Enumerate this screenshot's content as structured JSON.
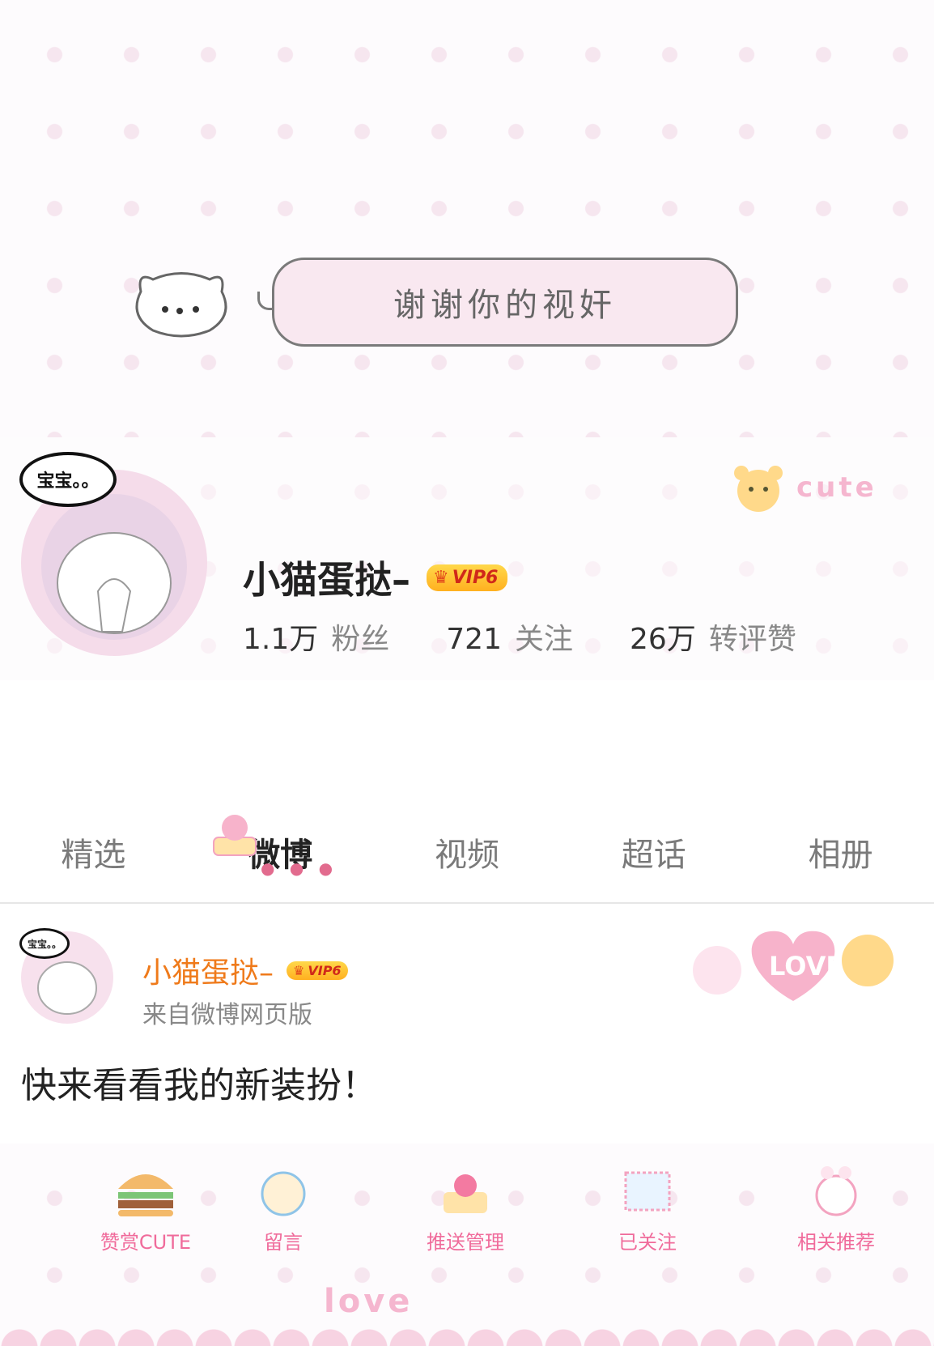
{
  "cover": {
    "bubble_text": "谢谢你的视奸"
  },
  "profile": {
    "avatar_speech": "宝宝。。",
    "username": "小猫蛋挞–",
    "vip_badge": "VIP6",
    "sticker_text": "cute",
    "stats": [
      {
        "value": "1.1万",
        "label": "粉丝"
      },
      {
        "value": "721",
        "label": "关注"
      },
      {
        "value": "26万",
        "label": "转评赞"
      }
    ]
  },
  "tabs": [
    {
      "label": "精选"
    },
    {
      "label": "微博"
    },
    {
      "label": "视频"
    },
    {
      "label": "超话"
    },
    {
      "label": "相册"
    }
  ],
  "post": {
    "avatar_speech": "宝宝。。",
    "author": "小猫蛋挞–",
    "vip_badge": "VIP6",
    "source": "来自微博网页版",
    "text": "快来看看我的新装扮！",
    "sticker_text": "LOVE"
  },
  "footer": {
    "buttons": [
      {
        "label": "赞赏CUTE"
      },
      {
        "label": "留言"
      },
      {
        "label": "推送管理"
      },
      {
        "label": "已关注"
      },
      {
        "label": "相关推荐"
      }
    ],
    "decor_text": "love"
  },
  "colors": {
    "accent_orange": "#ef7a1a",
    "pink": "#f06b9b",
    "vip_gold": "#ffc43a"
  }
}
